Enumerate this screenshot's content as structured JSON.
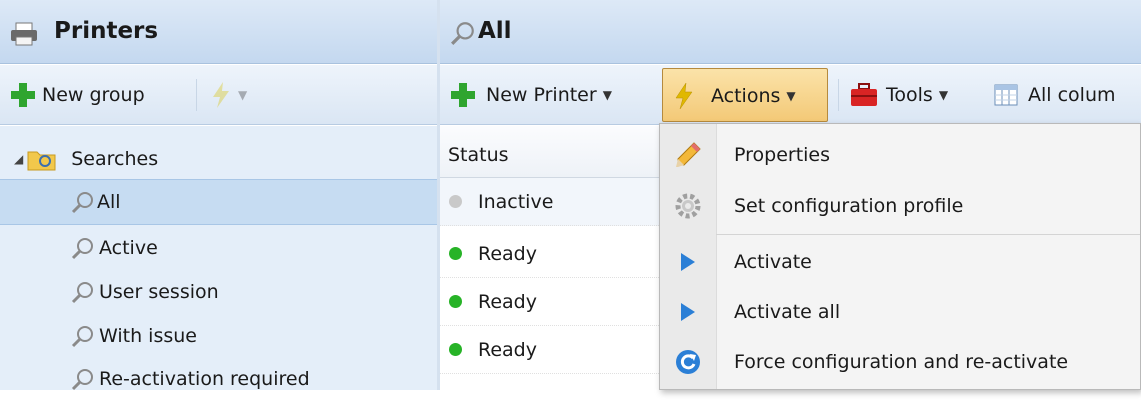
{
  "left_panel": {
    "title": "Printers",
    "toolbar": {
      "new_group_label": "New group"
    },
    "tree": {
      "root_label": "Searches",
      "items": [
        {
          "label": "All",
          "selected": true
        },
        {
          "label": "Active",
          "selected": false
        },
        {
          "label": "User session",
          "selected": false
        },
        {
          "label": "With issue",
          "selected": false
        },
        {
          "label": "Re-activation required",
          "selected": false
        }
      ]
    }
  },
  "right_panel": {
    "title": "All",
    "toolbar": {
      "new_printer_label": "New Printer",
      "actions_label": "Actions",
      "tools_label": "Tools",
      "columns_label": "All colum"
    },
    "grid": {
      "column_header": "Status",
      "rows": [
        {
          "status": "Inactive",
          "color": "#b8b8b8"
        },
        {
          "status": "Ready",
          "color": "#27b327"
        },
        {
          "status": "Ready",
          "color": "#27b327"
        },
        {
          "status": "Ready",
          "color": "#27b327"
        }
      ]
    }
  },
  "actions_menu": {
    "items": [
      {
        "label": "Properties",
        "icon": "pencil-icon"
      },
      {
        "label": "Set configuration profile",
        "icon": "gear-icon"
      },
      {
        "label": "Activate",
        "icon": "play-icon"
      },
      {
        "label": "Activate all",
        "icon": "play-icon"
      },
      {
        "label": "Force configuration and re-activate",
        "icon": "refresh-icon"
      }
    ]
  },
  "colors": {
    "accent_green": "#2fa52f",
    "selection": "#c6dcf2",
    "menu_highlight": "#f3c977",
    "play_blue": "#2b7fd6"
  }
}
